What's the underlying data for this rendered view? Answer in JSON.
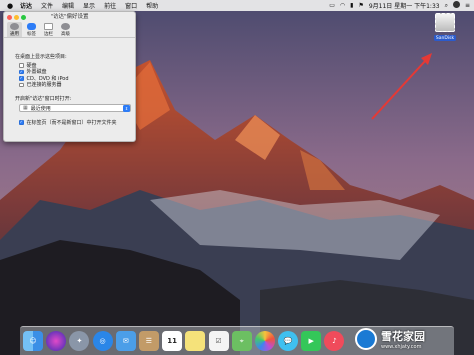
{
  "menubar": {
    "apple_icon": "apple-icon",
    "items": [
      "访达",
      "文件",
      "编辑",
      "显示",
      "前往",
      "窗口",
      "帮助"
    ],
    "date_time": "9月11日 星期一 下午1:33",
    "status_icons": [
      "cast-icon",
      "wifi-icon",
      "battery-icon",
      "flag-icon",
      "search-icon",
      "siri-icon",
      "list-icon"
    ]
  },
  "prefs": {
    "title": "\"访达\"偏好设置",
    "tabs": [
      {
        "label": "通用",
        "icon": "gear-icon",
        "color": "#8e8e93"
      },
      {
        "label": "标签",
        "icon": "tag-icon",
        "color": "#2d7cf6"
      },
      {
        "label": "边栏",
        "icon": "sidebar-icon",
        "color": "#ffffff"
      },
      {
        "label": "高级",
        "icon": "advanced-gear-icon",
        "color": "#8e8e93"
      }
    ],
    "desktop_show_label": "在桌面上显示这些项目:",
    "desktop_items": [
      {
        "label": "硬盘",
        "checked": false
      },
      {
        "label": "外置磁盘",
        "checked": true
      },
      {
        "label": "CD、DVD 和 iPod",
        "checked": true
      },
      {
        "label": "已连接的服务器",
        "checked": false
      }
    ],
    "new_window_label": "开启新\"访达\"窗口时打开:",
    "new_window_value": "最近使用",
    "open_folders_tabs": {
      "label": "在标签页（而不是新窗口）中打开文件夹",
      "checked": true
    }
  },
  "desktop": {
    "drive_label": "SanDisk"
  },
  "dock": {
    "apps": [
      {
        "name": "finder-icon",
        "color": "#3b8fe6"
      },
      {
        "name": "siri-icon",
        "color": "#6b3bd6"
      },
      {
        "name": "launchpad-icon",
        "color": "#8a96a8"
      },
      {
        "name": "safari-icon",
        "color": "#2a86e8"
      },
      {
        "name": "mail-icon",
        "color": "#4b9ee8"
      },
      {
        "name": "contacts-icon",
        "color": "#c29b68"
      },
      {
        "name": "calendar-icon",
        "color": "#ffffff",
        "text": "11"
      },
      {
        "name": "notes-icon",
        "color": "#f5e27a"
      },
      {
        "name": "reminders-icon",
        "color": "#f4f4f4"
      },
      {
        "name": "maps-icon",
        "color": "#6cbf62"
      },
      {
        "name": "photos-icon",
        "color": "#f2f2f2"
      },
      {
        "name": "messages-icon",
        "color": "#3fc0f0"
      },
      {
        "name": "facetime-icon",
        "color": "#34c759"
      },
      {
        "name": "music-icon",
        "color": "#f04b5b"
      }
    ]
  },
  "watermark": {
    "title": "雪花家园",
    "url": "www.xhjaty.com"
  },
  "colors": {
    "accent": "#2d7cf6",
    "annotation_arrow": "#e53935"
  }
}
